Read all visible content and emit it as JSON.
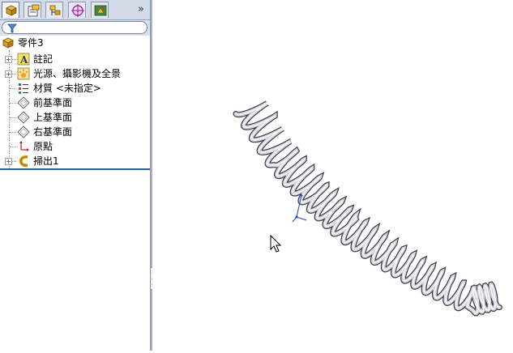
{
  "panel": {
    "tabs": [
      {
        "name": "featuremanager-tab",
        "icon": "feature-tree-icon"
      },
      {
        "name": "propertymanager-tab",
        "icon": "property-manager-icon"
      },
      {
        "name": "configurationmanager-tab",
        "icon": "configuration-manager-icon"
      },
      {
        "name": "dimxpert-tab",
        "icon": "dimxpert-icon"
      },
      {
        "name": "display-manager-tab",
        "icon": "display-manager-icon"
      }
    ],
    "more_label": "»"
  },
  "tree": {
    "root": "零件3",
    "items": [
      {
        "label": "註記",
        "icon": "annotations-icon",
        "expandable": true
      },
      {
        "label": "光源、攝影機及全景",
        "icon": "lights-cameras-icon",
        "expandable": true
      },
      {
        "label": "材質 <未指定>",
        "icon": "material-icon",
        "expandable": false
      },
      {
        "label": "前基準面",
        "icon": "plane-icon",
        "expandable": false
      },
      {
        "label": "上基準面",
        "icon": "plane-icon",
        "expandable": false
      },
      {
        "label": "右基準面",
        "icon": "plane-icon",
        "expandable": false
      },
      {
        "label": "原點",
        "icon": "origin-icon",
        "expandable": false
      },
      {
        "label": "掃出1",
        "icon": "sweep-feature-icon",
        "expandable": true
      }
    ]
  },
  "colors": {
    "panel_bg": "#d9e1ee",
    "tree_bg": "#ffffff",
    "accent": "#2f5e98"
  }
}
